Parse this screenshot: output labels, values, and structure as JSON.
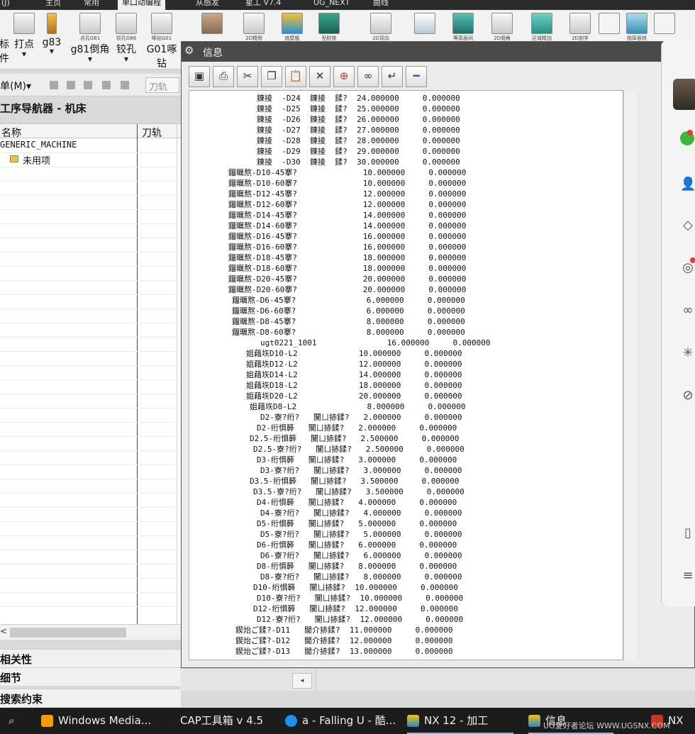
{
  "ribbon": {
    "tabs": [
      "(J)",
      "主页",
      "常用",
      "单口动编程",
      "从感发",
      "星工 V7.4",
      "UG_NEXT",
      "曲线"
    ],
    "buttons": [
      {
        "label": "标件",
        "caption": ""
      },
      {
        "label": "打点",
        "caption": ""
      },
      {
        "label": "g83",
        "caption": ""
      },
      {
        "label": "g81倒角",
        "caption": "点孔G81"
      },
      {
        "label": "铰孔",
        "caption": "铰孔G86"
      },
      {
        "label": "G01啄钻",
        "caption": "啄钻G01"
      }
    ],
    "icon_captions": [
      "2D精侧",
      "底壁粗",
      "型腔铣",
      "2D双向",
      "等高层间",
      "2D倒角",
      "区域精加",
      "2D刻字",
      "指挥面铣"
    ]
  },
  "navigator": {
    "menu_label": "单(M)▾",
    "tool_field": "刀轨",
    "title": "工序导航器 - 机床",
    "col_name": "名称",
    "col_path": "刀轨",
    "rows": [
      "GENERIC_MACHINE",
      "未用项"
    ],
    "related_label": "相关性",
    "detail_label": "细节",
    "search_label": "搜索约束"
  },
  "dialog": {
    "title": "信息",
    "toolbar": [
      "save",
      "print",
      "cut",
      "copy",
      "paste",
      "delete",
      "find",
      "binoculars",
      "wrap",
      "minimize"
    ],
    "lines": [
      {
        "indent": 19,
        "text": "錬掕  -D24  錬掕  鍒?  24.000000     0.000000"
      },
      {
        "indent": 19,
        "text": "錬掕  -D25  錬掕  鍒?  25.000000     0.000000"
      },
      {
        "indent": 19,
        "text": "錬掕  -D26  錬掕  鍒?  26.000000     0.000000"
      },
      {
        "indent": 19,
        "text": "錬掕  -D27  錬掕  鍒?  27.000000     0.000000"
      },
      {
        "indent": 19,
        "text": "錬掕  -D28  錬掕  鍒?  28.000000     0.000000"
      },
      {
        "indent": 19,
        "text": "錬掕  -D29  錬掕  鍒?  29.000000     0.000000"
      },
      {
        "indent": 19,
        "text": "錬掕  -D30  錬掕  鍒?  30.000000     0.000000"
      },
      {
        "indent": 11,
        "text": "鐂曞熬-D10-45搴?              10.000000     0.000000"
      },
      {
        "indent": 11,
        "text": "鐂曞熬-D10-60搴?              10.000000     0.000000"
      },
      {
        "indent": 11,
        "text": "鐂曞熬-D12-45搴?              12.000000     0.000000"
      },
      {
        "indent": 11,
        "text": "鐂曞熬-D12-60搴?              12.000000     0.000000"
      },
      {
        "indent": 11,
        "text": "鐂曞熬-D14-45搴?              14.000000     0.000000"
      },
      {
        "indent": 11,
        "text": "鐂曞熬-D14-60搴?              14.000000     0.000000"
      },
      {
        "indent": 11,
        "text": "鐂曞熬-D16-45搴?              16.000000     0.000000"
      },
      {
        "indent": 11,
        "text": "鐂曞熬-D16-60搴?              16.000000     0.000000"
      },
      {
        "indent": 11,
        "text": "鐂曞熬-D18-45搴?              18.000000     0.000000"
      },
      {
        "indent": 11,
        "text": "鐂曞熬-D18-60搴?              18.000000     0.000000"
      },
      {
        "indent": 11,
        "text": "鐂曞熬-D20-45搴?              20.000000     0.000000"
      },
      {
        "indent": 11,
        "text": "鐂曞熬-D20-60搴?              20.000000     0.000000"
      },
      {
        "indent": 12,
        "text": "鐂曞熬-D6-45搴?               6.000000     0.000000"
      },
      {
        "indent": 12,
        "text": "鐂曞熬-D6-60搴?               6.000000     0.000000"
      },
      {
        "indent": 12,
        "text": "鐂曞熬-D8-45搴?               8.000000     0.000000"
      },
      {
        "indent": 12,
        "text": "鐂曞熬-D8-60搴?               8.000000     0.000000"
      },
      {
        "indent": 20,
        "text": "ugt0221_1001               16.000000     0.000000"
      },
      {
        "indent": 16,
        "text": "姐藉垁D10-L2             10.000000     0.000000"
      },
      {
        "indent": 16,
        "text": "姐藉垁D12-L2             12.000000     0.000000"
      },
      {
        "indent": 16,
        "text": "姐藉垁D14-L2             14.000000     0.000000"
      },
      {
        "indent": 16,
        "text": "姐藉垁D18-L2             18.000000     0.000000"
      },
      {
        "indent": 16,
        "text": "姐藉垁D20-L2             20.000000     0.000000"
      },
      {
        "indent": 17,
        "text": "姐藉垁D8-L2               8.000000     0.000000"
      },
      {
        "indent": 20,
        "text": "D2-寮?绗?   闃ㄩ捇鍒?   2.000000     0.000000"
      },
      {
        "indent": 19,
        "text": "D2-绗惧簳   闃ㄩ捇鍒?   2.000000     0.000000"
      },
      {
        "indent": 17,
        "text": "D2.5-绗惧簳   闃ㄩ捇鍒?   2.500000     0.000000"
      },
      {
        "indent": 18,
        "text": "D2.5-寮?绗?   闃ㄩ捇鍒?   2.500000     0.000000"
      },
      {
        "indent": 19,
        "text": "D3-绗惧簳   闃ㄩ捇鍒?   3.000000     0.000000"
      },
      {
        "indent": 20,
        "text": "D3-寮?绗?   闃ㄩ捇鍒?   3.000000     0.000000"
      },
      {
        "indent": 17,
        "text": "D3.5-绗惧簳   闃ㄩ捇鍒?   3.500000     0.000000"
      },
      {
        "indent": 18,
        "text": "D3.5-寮?绗?   闃ㄩ捇鍒?   3.500000     0.000000"
      },
      {
        "indent": 19,
        "text": "D4-绗惧簳   闃ㄩ捇鍒?   4.000000     0.000000"
      },
      {
        "indent": 20,
        "text": "D4-寮?绗?   闃ㄩ捇鍒?   4.000000     0.000000"
      },
      {
        "indent": 19,
        "text": "D5-绗惧簳   闃ㄩ捇鍒?   5.000000     0.000000"
      },
      {
        "indent": 20,
        "text": "D5-寮?绗?   闃ㄩ捇鍒?   5.000000     0.000000"
      },
      {
        "indent": 19,
        "text": "D6-绗惧簳   闃ㄩ捇鍒?   6.000000     0.000000"
      },
      {
        "indent": 20,
        "text": "D6-寮?绗?   闃ㄩ捇鍒?   6.000000     0.000000"
      },
      {
        "indent": 19,
        "text": "D8-绗惧簳   闃ㄩ捇鍒?   8.000000     0.000000"
      },
      {
        "indent": 20,
        "text": "D8-寮?绗?   闃ㄩ捇鍒?   8.000000     0.000000"
      },
      {
        "indent": 18,
        "text": "D10-绗惧簳   闃ㄩ捇鍒?  10.000000     0.000000"
      },
      {
        "indent": 19,
        "text": "D10-寮?绗?   闃ㄩ捇鍒?  10.000000     0.000000"
      },
      {
        "indent": 18,
        "text": "D12-绗惧簳   闃ㄩ捇鍒?  12.000000     0.000000"
      },
      {
        "indent": 19,
        "text": "D12-寮?绗?   闃ㄩ捇鍒?  12.000000     0.000000"
      },
      {
        "indent": 13,
        "text": "鍥炲ご鍒?-D11   閫介捇鍒?  11.000000     0.000000"
      },
      {
        "indent": 13,
        "text": "鍥炲ご鍒?-D12   閫介捇鍒?  12.000000     0.000000"
      },
      {
        "indent": 13,
        "text": "鍥炲ご鍒?-D13   閫介捇鍒?  13.000000     0.000000"
      }
    ]
  },
  "taskbar": {
    "items": [
      {
        "label": "Windows Media...",
        "color": "#f39c12"
      },
      {
        "label": "CAP工具箱 v 4.5",
        "color": "#1c1c1c"
      },
      {
        "label": "a - Falling U - 酷...",
        "color": "#1f8ef1"
      },
      {
        "label": "NX 12 - 加工",
        "color": "#d35400"
      },
      {
        "label": "信息",
        "color": "#d35400"
      },
      {
        "label": "NX",
        "color": "#d35400"
      }
    ],
    "watermark": "UG爱好者论坛 WWW.UGSNX.COM"
  }
}
